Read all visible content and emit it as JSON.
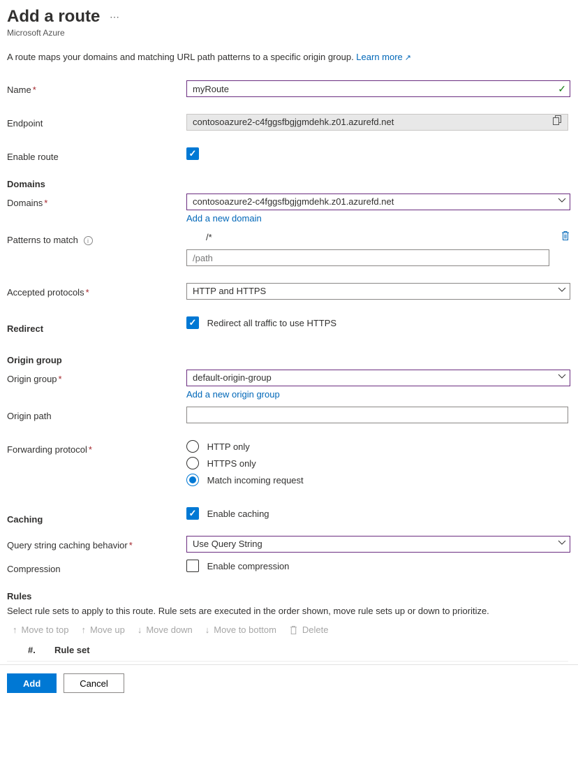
{
  "header": {
    "title": "Add a route",
    "subtitle": "Microsoft Azure"
  },
  "description": {
    "text": "A route maps your domains and matching URL path patterns to a specific origin group. ",
    "link": "Learn more"
  },
  "labels": {
    "name": "Name",
    "endpoint": "Endpoint",
    "enable_route": "Enable route",
    "domains_section": "Domains",
    "domains": "Domains",
    "add_domain": "Add a new domain",
    "patterns": "Patterns to match",
    "accepted_protocols": "Accepted protocols",
    "redirect": "Redirect",
    "redirect_label": "Redirect all traffic to use HTTPS",
    "origin_group_section": "Origin group",
    "origin_group": "Origin group",
    "add_origin_group": "Add a new origin group",
    "origin_path": "Origin path",
    "forwarding_protocol": "Forwarding protocol",
    "caching": "Caching",
    "enable_caching": "Enable caching",
    "query_caching": "Query string caching behavior",
    "compression": "Compression",
    "enable_compression": "Enable compression",
    "rules_section": "Rules",
    "rules_desc": "Select rule sets to apply to this route. Rule sets are executed in the order shown, move rule sets up or down to prioritize.",
    "col_num": "#.",
    "col_ruleset": "Rule set"
  },
  "values": {
    "name": "myRoute",
    "endpoint": "contosoazure2-c4fggsfbgjgmdehk.z01.azurefd.net",
    "domains_selected": "contosoazure2-c4fggsfbgjgmdehk.z01.azurefd.net",
    "pattern0": "/*",
    "pattern_placeholder": "/path",
    "accepted_protocols": "HTTP and HTTPS",
    "origin_group": "default-origin-group",
    "origin_path": "",
    "query_caching": "Use Query String"
  },
  "forwarding_options": {
    "http": "HTTP only",
    "https": "HTTPS only",
    "match": "Match incoming request"
  },
  "toolbar": {
    "move_top": "Move to top",
    "move_up": "Move up",
    "move_down": "Move down",
    "move_bottom": "Move to bottom",
    "delete": "Delete"
  },
  "footer": {
    "add": "Add",
    "cancel": "Cancel"
  }
}
